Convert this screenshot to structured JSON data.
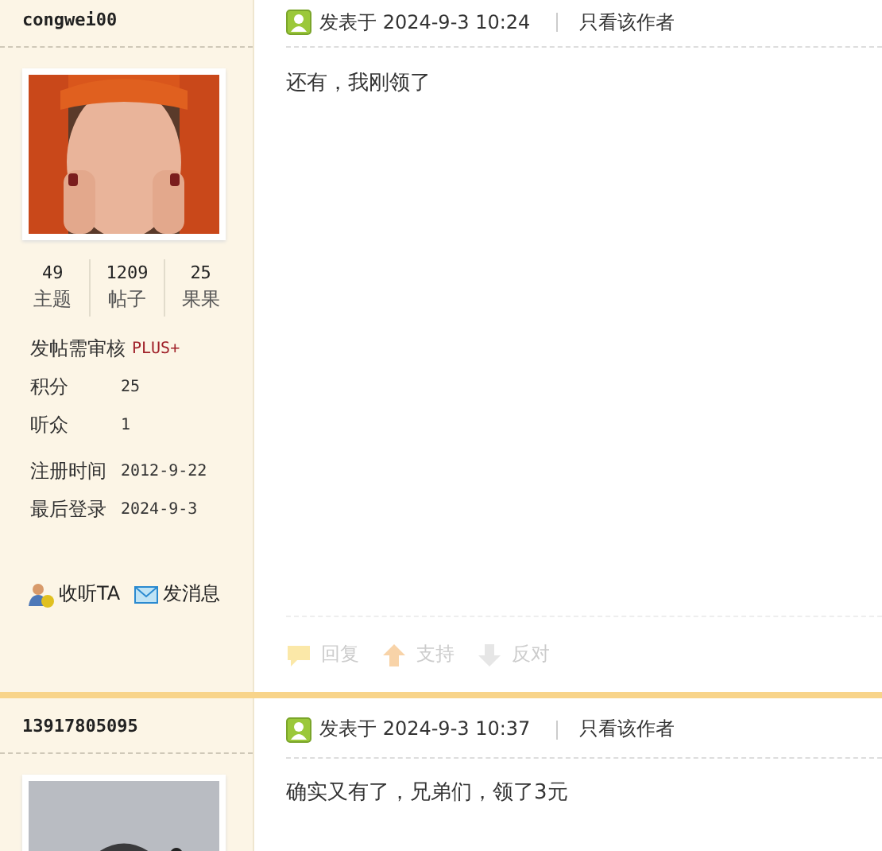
{
  "posts": [
    {
      "author": {
        "name": "congwei00",
        "stats": [
          {
            "value": "49",
            "label": "主题"
          },
          {
            "value": "1209",
            "label": "帖子"
          },
          {
            "value": "25",
            "label": "果果"
          }
        ],
        "info": [
          [
            {
              "label": "发帖需审核",
              "value": "PLUS+",
              "kind": "badge"
            },
            {
              "label": "积分",
              "value": "25",
              "kind": "field"
            },
            {
              "label": "听众",
              "value": "1",
              "kind": "field"
            }
          ],
          [
            {
              "label": "注册时间",
              "value": "2012-9-22",
              "kind": "field"
            },
            {
              "label": "最后登录",
              "value": "2024-9-3",
              "kind": "field"
            }
          ]
        ],
        "links": [
          {
            "label": "收听TA",
            "kind": "follow"
          },
          {
            "label": "发消息",
            "kind": "message"
          }
        ]
      },
      "posted": "发表于 2024-9-3 10:24",
      "author_only": "只看该作者",
      "content": "还有，我刚领了",
      "actions": [
        {
          "label": "回复",
          "kind": "reply"
        },
        {
          "label": "支持",
          "kind": "up"
        },
        {
          "label": "反对",
          "kind": "down"
        }
      ]
    },
    {
      "author": {
        "name": "13917805095"
      },
      "posted": "发表于 2024-9-3 10:37",
      "author_only": "只看该作者",
      "content": "确实又有了，兄弟们，领了3元"
    }
  ]
}
